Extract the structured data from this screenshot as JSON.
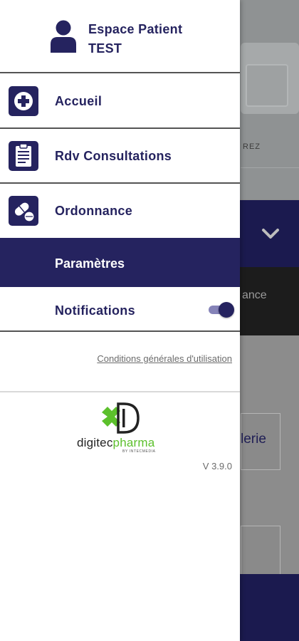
{
  "header": {
    "line1": "Espace Patient",
    "line2": "TEST"
  },
  "menu": {
    "home": "Accueil",
    "appointments": "Rdv Consultations",
    "prescription": "Ordonnance"
  },
  "settings": {
    "title": "Paramètres",
    "notifications_label": "Notifications",
    "notifications_enabled": true
  },
  "cgu_link": "Conditions générales d'utilisation",
  "brand": {
    "part1": "digitec",
    "part2": "pharma",
    "sub": "BY INTECMEDIA",
    "version": "V 3.9.0"
  },
  "background": {
    "hero_text": "REZ",
    "darkbar_text": "ance",
    "card_text": "lerie"
  },
  "colors": {
    "primary": "#25235f",
    "accent_green": "#5cc02c",
    "toggle_track": "#8583b8"
  }
}
